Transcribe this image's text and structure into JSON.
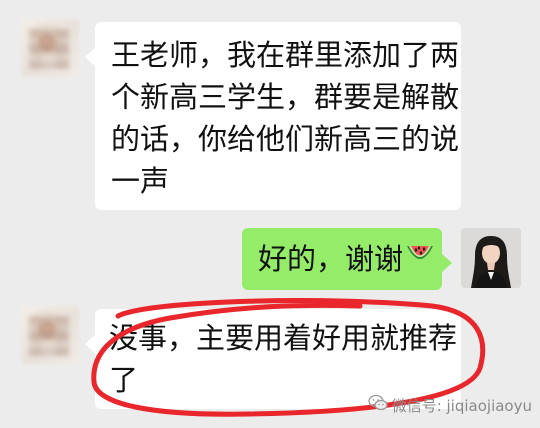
{
  "chat": {
    "messages": [
      {
        "side": "left",
        "lines": [
          "王老师，我在群里添加了两",
          "个新高三学生，群要是解散",
          "的话，你给他们新高三的说",
          "一声"
        ]
      },
      {
        "side": "right",
        "text": "好的，谢谢",
        "emoji": "watermelon-icon"
      },
      {
        "side": "left",
        "lines": [
          "没事，主要用着好用就推荐",
          "了"
        ]
      }
    ]
  },
  "watermark": {
    "text": "微信号: jiqiaojiaoyu"
  },
  "colors": {
    "background": "#ececec",
    "bubble_left": "#ffffff",
    "bubble_right": "#95ec69",
    "annotation": "#e8262b"
  }
}
